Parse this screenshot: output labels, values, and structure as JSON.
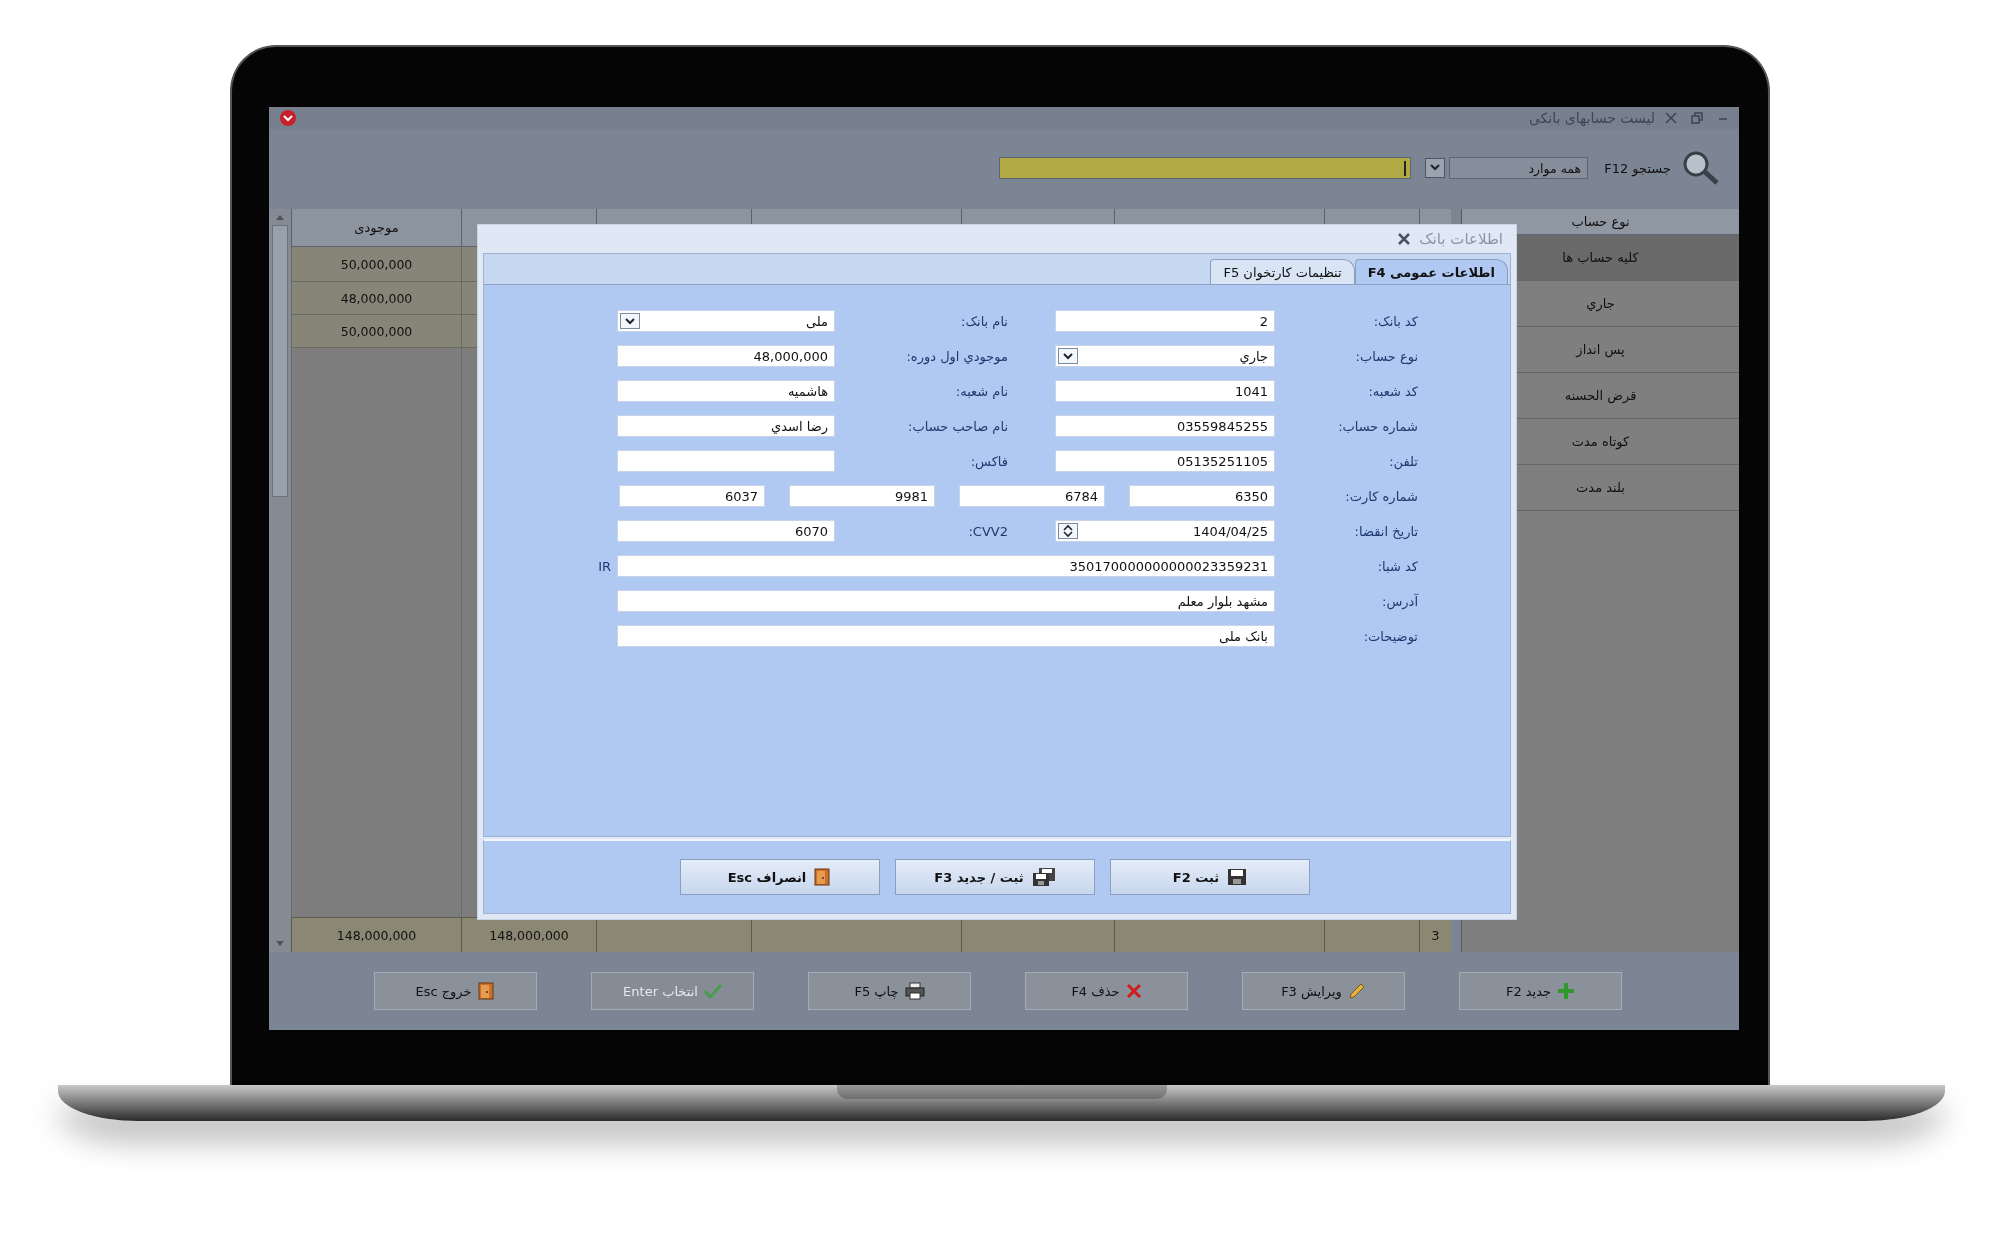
{
  "window": {
    "title": "لیست حسابهای بانکی"
  },
  "search": {
    "label": "جستجو F12",
    "scope": "همه موارد"
  },
  "table": {
    "columns": [
      "موجودی"
    ],
    "rows": [
      {
        "balance": "50,000,000"
      },
      {
        "balance": "48,000,000"
      },
      {
        "balance": "50,000,000"
      }
    ],
    "footer": {
      "balance_total": "148,000,000",
      "column_2_total": "148,000,000",
      "row_count": "3"
    }
  },
  "sidebar": {
    "title": "نوع حساب",
    "items": [
      {
        "label": "کلیه حساب ها",
        "selected": true
      },
      {
        "label": "جاري",
        "selected": false
      },
      {
        "label": "پس انداز",
        "selected": false
      },
      {
        "label": "قرض الحسنه",
        "selected": false
      },
      {
        "label": "کوتاه مدت",
        "selected": false
      },
      {
        "label": "بلند مدت",
        "selected": false
      }
    ]
  },
  "dialog": {
    "title": "اطلاعات بانک",
    "tabs": [
      {
        "label": "اطلاعات عمومی F4",
        "selected": true
      },
      {
        "label": "تنظیمات کارتخوان F5",
        "selected": false
      }
    ],
    "rows": [
      {
        "kind": "pair",
        "fields": [
          {
            "label": "کد بانک:",
            "value": "2",
            "kind": "text"
          },
          {
            "label": "نام بانک:",
            "value": "ملی",
            "kind": "dropdown"
          }
        ]
      },
      {
        "kind": "pair",
        "fields": [
          {
            "label": "نوع حساب:",
            "value": "جاري",
            "kind": "dropdown"
          },
          {
            "label": "موجودي اول دوره:",
            "value": "48,000,000",
            "kind": "text"
          }
        ]
      },
      {
        "kind": "pair",
        "fields": [
          {
            "label": "کد شعبه:",
            "value": "1041",
            "kind": "text"
          },
          {
            "label": "نام شعبه:",
            "value": "هاشمیه",
            "kind": "text"
          }
        ]
      },
      {
        "kind": "pair",
        "fields": [
          {
            "label": "شماره حساب:",
            "value": "03559845255",
            "kind": "text"
          },
          {
            "label": "نام صاحب حساب:",
            "value": "رضا اسدي",
            "kind": "text"
          }
        ]
      },
      {
        "kind": "pair",
        "fields": [
          {
            "label": "تلفن:",
            "value": "05135251105",
            "kind": "text"
          },
          {
            "label": "فاکس:",
            "kind": "text"
          }
        ]
      },
      {
        "kind": "split",
        "label": "شماره کارت:",
        "values": [
          "6350",
          "6784",
          "9981",
          "6037"
        ]
      },
      {
        "kind": "pair",
        "fields": [
          {
            "label": "تاریخ انقضا:",
            "value": "1404/04/25",
            "kind": "spin"
          },
          {
            "label": "CVV2:",
            "value": "6070",
            "kind": "text"
          }
        ]
      },
      {
        "kind": "wide",
        "label": "کد شبا:",
        "value": "350170000000000023359231",
        "suffix": "IR"
      },
      {
        "kind": "wide",
        "label": "آدرس:",
        "value": "مشهد بلوار معلم"
      },
      {
        "kind": "wide",
        "label": "توضیحات:",
        "value": "بانک ملی"
      }
    ],
    "buttons": [
      {
        "label": "ثبت F2",
        "kind": "save"
      },
      {
        "label": "ثبت / جدید F3",
        "kind": "save-new"
      },
      {
        "label": "انصراف Esc",
        "kind": "exit"
      }
    ]
  },
  "toolbar": [
    {
      "label": "جدید F2",
      "kind": "add",
      "disabled": false
    },
    {
      "label": "ویرایش F3",
      "kind": "edit",
      "disabled": false
    },
    {
      "label": "حذف F4",
      "kind": "delete",
      "disabled": false
    },
    {
      "label": "چاپ F5",
      "kind": "print",
      "disabled": false
    },
    {
      "label": "انتخاب Enter",
      "kind": "select",
      "disabled": true
    },
    {
      "label": "خروج Esc",
      "kind": "exit",
      "disabled": false
    }
  ]
}
